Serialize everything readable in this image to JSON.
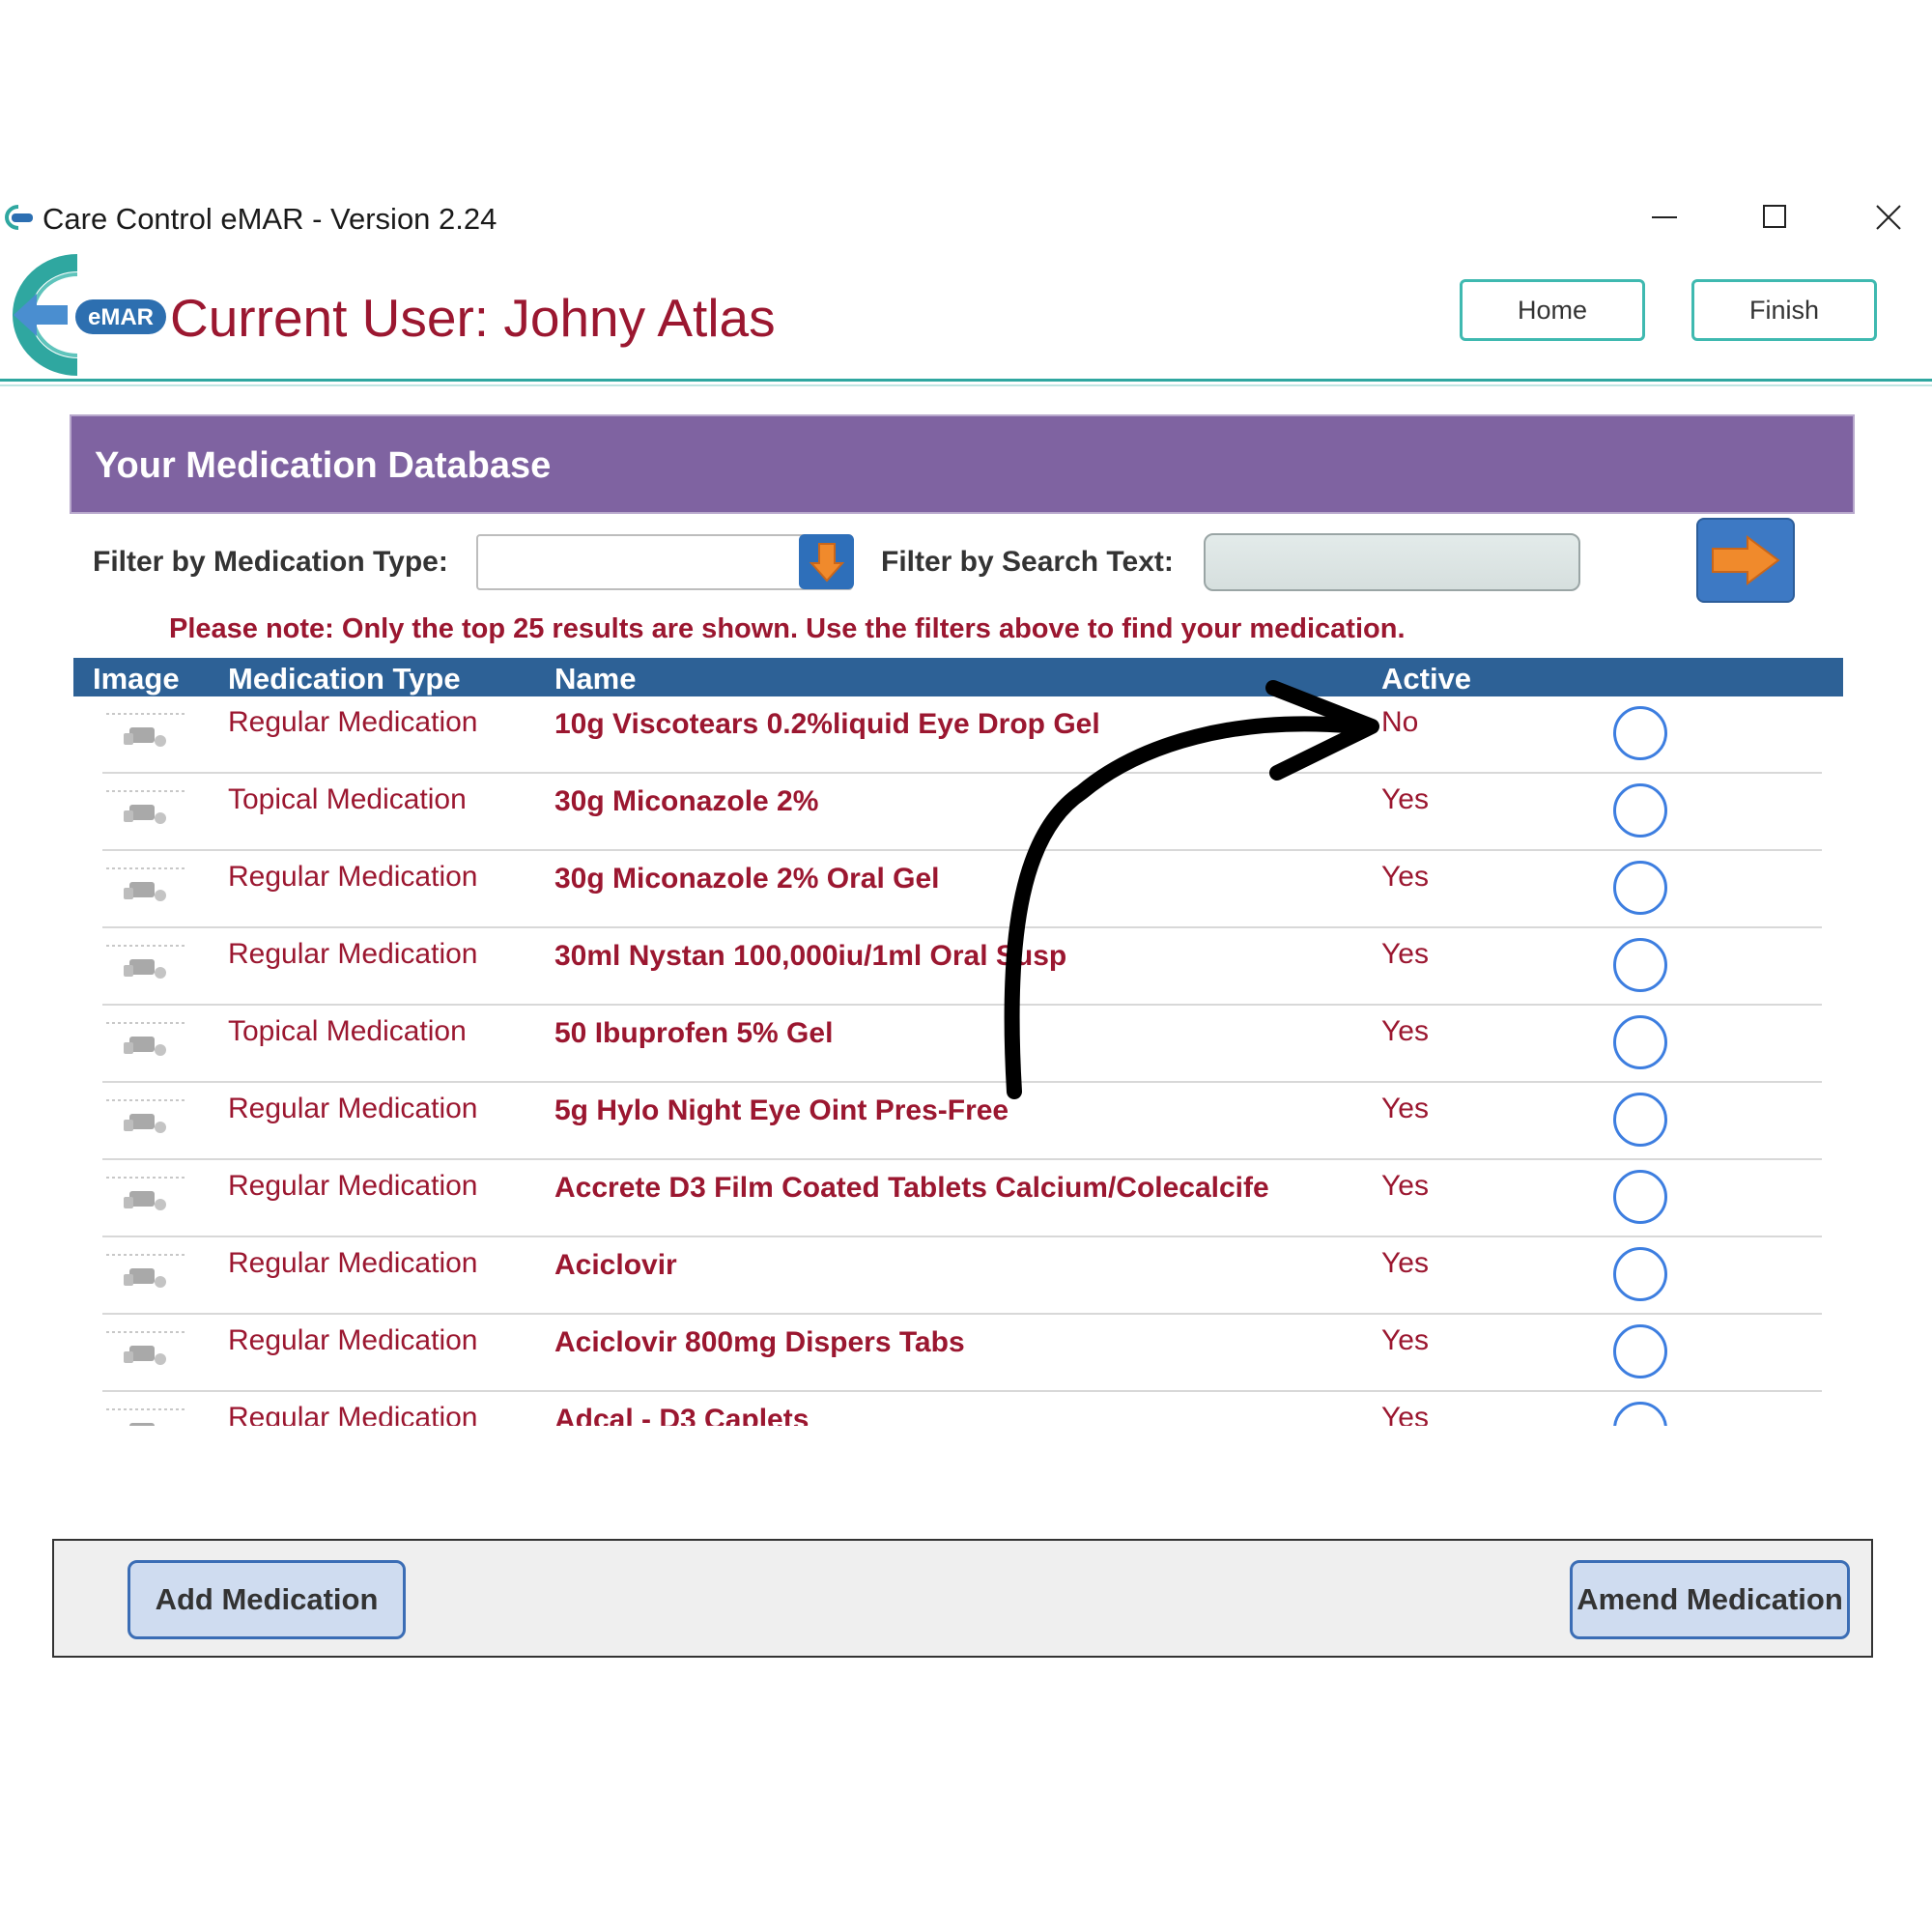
{
  "window": {
    "title": "Care Control eMAR - Version 2.24"
  },
  "header": {
    "logo_badge": "eMAR",
    "current_user": "Current User: Johny Atlas",
    "home_label": "Home",
    "finish_label": "Finish"
  },
  "panel": {
    "title": "Your Medication Database"
  },
  "filters": {
    "type_label": "Filter by Medication Type:",
    "type_value": "",
    "search_label": "Filter by Search Text:",
    "search_value": ""
  },
  "note": "Please note: Only the top 25 results are shown.  Use the filters above to find your medication.",
  "table": {
    "headers": {
      "image": "Image",
      "type": "Medication Type",
      "name": "Name",
      "active": "Active"
    },
    "rows": [
      {
        "type": "Regular Medication",
        "name": "10g Viscotears 0.2%liquid Eye Drop Gel",
        "active": "No"
      },
      {
        "type": "Topical Medication",
        "name": "30g Miconazole 2%",
        "active": "Yes"
      },
      {
        "type": "Regular Medication",
        "name": "30g Miconazole 2% Oral Gel",
        "active": "Yes"
      },
      {
        "type": "Regular Medication",
        "name": "30ml Nystan 100,000iu/1ml Oral Susp",
        "active": "Yes"
      },
      {
        "type": "Topical Medication",
        "name": "50 Ibuprofen 5% Gel",
        "active": "Yes"
      },
      {
        "type": "Regular Medication",
        "name": "5g Hylo Night Eye Oint Pres-Free",
        "active": "Yes"
      },
      {
        "type": "Regular Medication",
        "name": "Accrete D3 Film Coated Tablets Calcium/Colecalcife",
        "active": "Yes"
      },
      {
        "type": "Regular Medication",
        "name": "Aciclovir",
        "active": "Yes"
      },
      {
        "type": "Regular Medication",
        "name": "Aciclovir 800mg Dispers Tabs",
        "active": "Yes"
      },
      {
        "type": "Regular Medication",
        "name": "Adcal - D3 Caplets",
        "active": "Yes"
      }
    ]
  },
  "footer": {
    "add_label": "Add Medication",
    "amend_label": "Amend Medication"
  },
  "colors": {
    "accent_teal": "#3fb9b0",
    "brand_red": "#9b1730",
    "panel_purple": "#7f63a1",
    "table_header_blue": "#2d6196",
    "button_orange": "#f08a2c"
  },
  "icons": [
    "care-control-logo-icon",
    "minimize-icon",
    "maximize-icon",
    "close-icon",
    "chevron-down-icon",
    "arrow-right-icon",
    "no-image-placeholder-icon",
    "radio-button-icon"
  ]
}
